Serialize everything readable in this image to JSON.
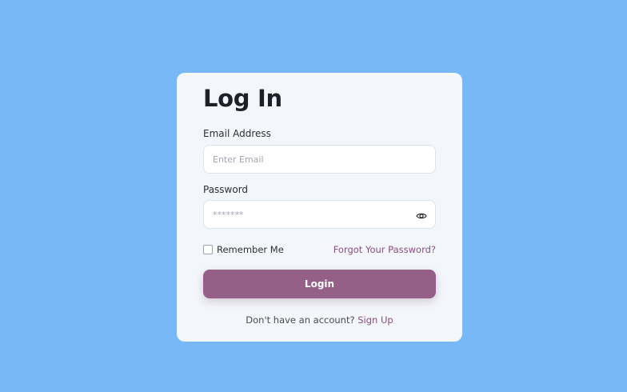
{
  "form": {
    "title": "Log In",
    "email_label": "Email Address",
    "email_placeholder": "Enter Email",
    "email_value": "",
    "password_label": "Password",
    "password_placeholder": "*******",
    "password_value": "",
    "password_toggle_icon": "eye-icon",
    "remember_label": "Remember Me",
    "remember_checked": false,
    "forgot_label": "Forgot Your Password?",
    "login_label": "Login",
    "signup_prompt": "Don't have an account?",
    "signup_label": "Sign Up"
  },
  "colors": {
    "background": "#79b8f7",
    "card": "#f3f6fb",
    "accent": "#946087",
    "link": "#8a4f7d"
  }
}
